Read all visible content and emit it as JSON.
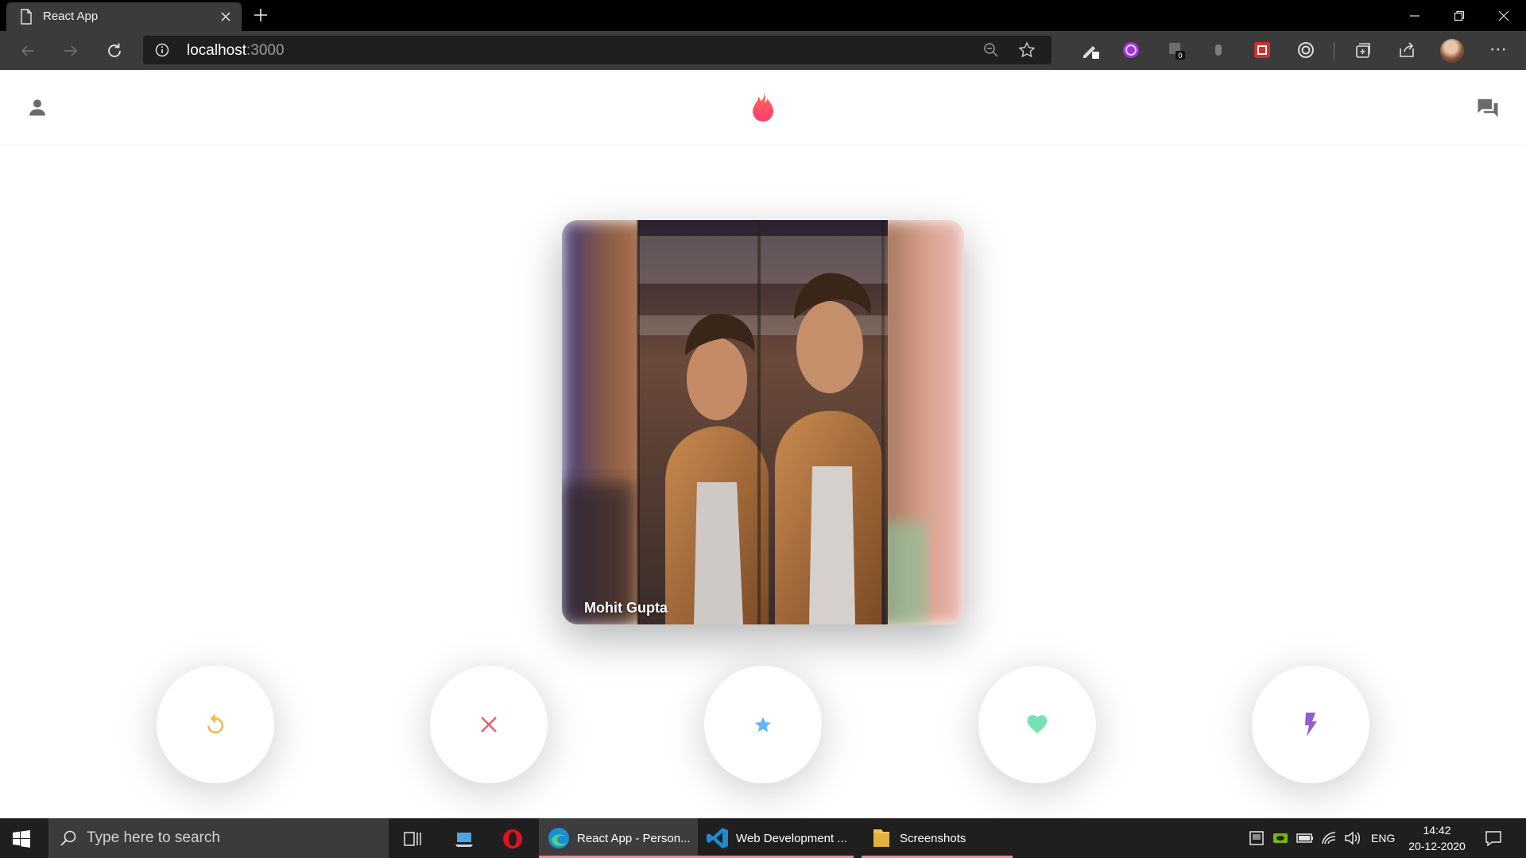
{
  "browser": {
    "tab_title": "React App",
    "url_host": "localhost",
    "url_port": ":3000",
    "extension_badge": "0"
  },
  "app": {
    "header": {
      "left_icon": "person-icon",
      "center_icon": "flame-logo-icon",
      "right_icon": "forum-icon",
      "brand_color": "#fe3c72"
    },
    "card": {
      "name": "Mohit Gupta"
    },
    "buttons": [
      {
        "name": "replay",
        "icon": "replay-icon",
        "color": "#f5b748"
      },
      {
        "name": "nope",
        "icon": "close-icon",
        "color": "#ec5e6f"
      },
      {
        "name": "super-like",
        "icon": "star-icon",
        "color": "#62b4f9"
      },
      {
        "name": "like",
        "icon": "heart-icon",
        "color": "#76e2b3"
      },
      {
        "name": "boost",
        "icon": "flash-icon",
        "color": "#915dd1"
      }
    ]
  },
  "taskbar": {
    "search_placeholder": "Type here to search",
    "apps": [
      {
        "label": "React App - Person...",
        "active": true
      },
      {
        "label": "Web Development ...",
        "active": false
      },
      {
        "label": "Screenshots",
        "active": false
      }
    ],
    "language": "ENG",
    "time": "14:42",
    "date": "20-12-2020"
  }
}
